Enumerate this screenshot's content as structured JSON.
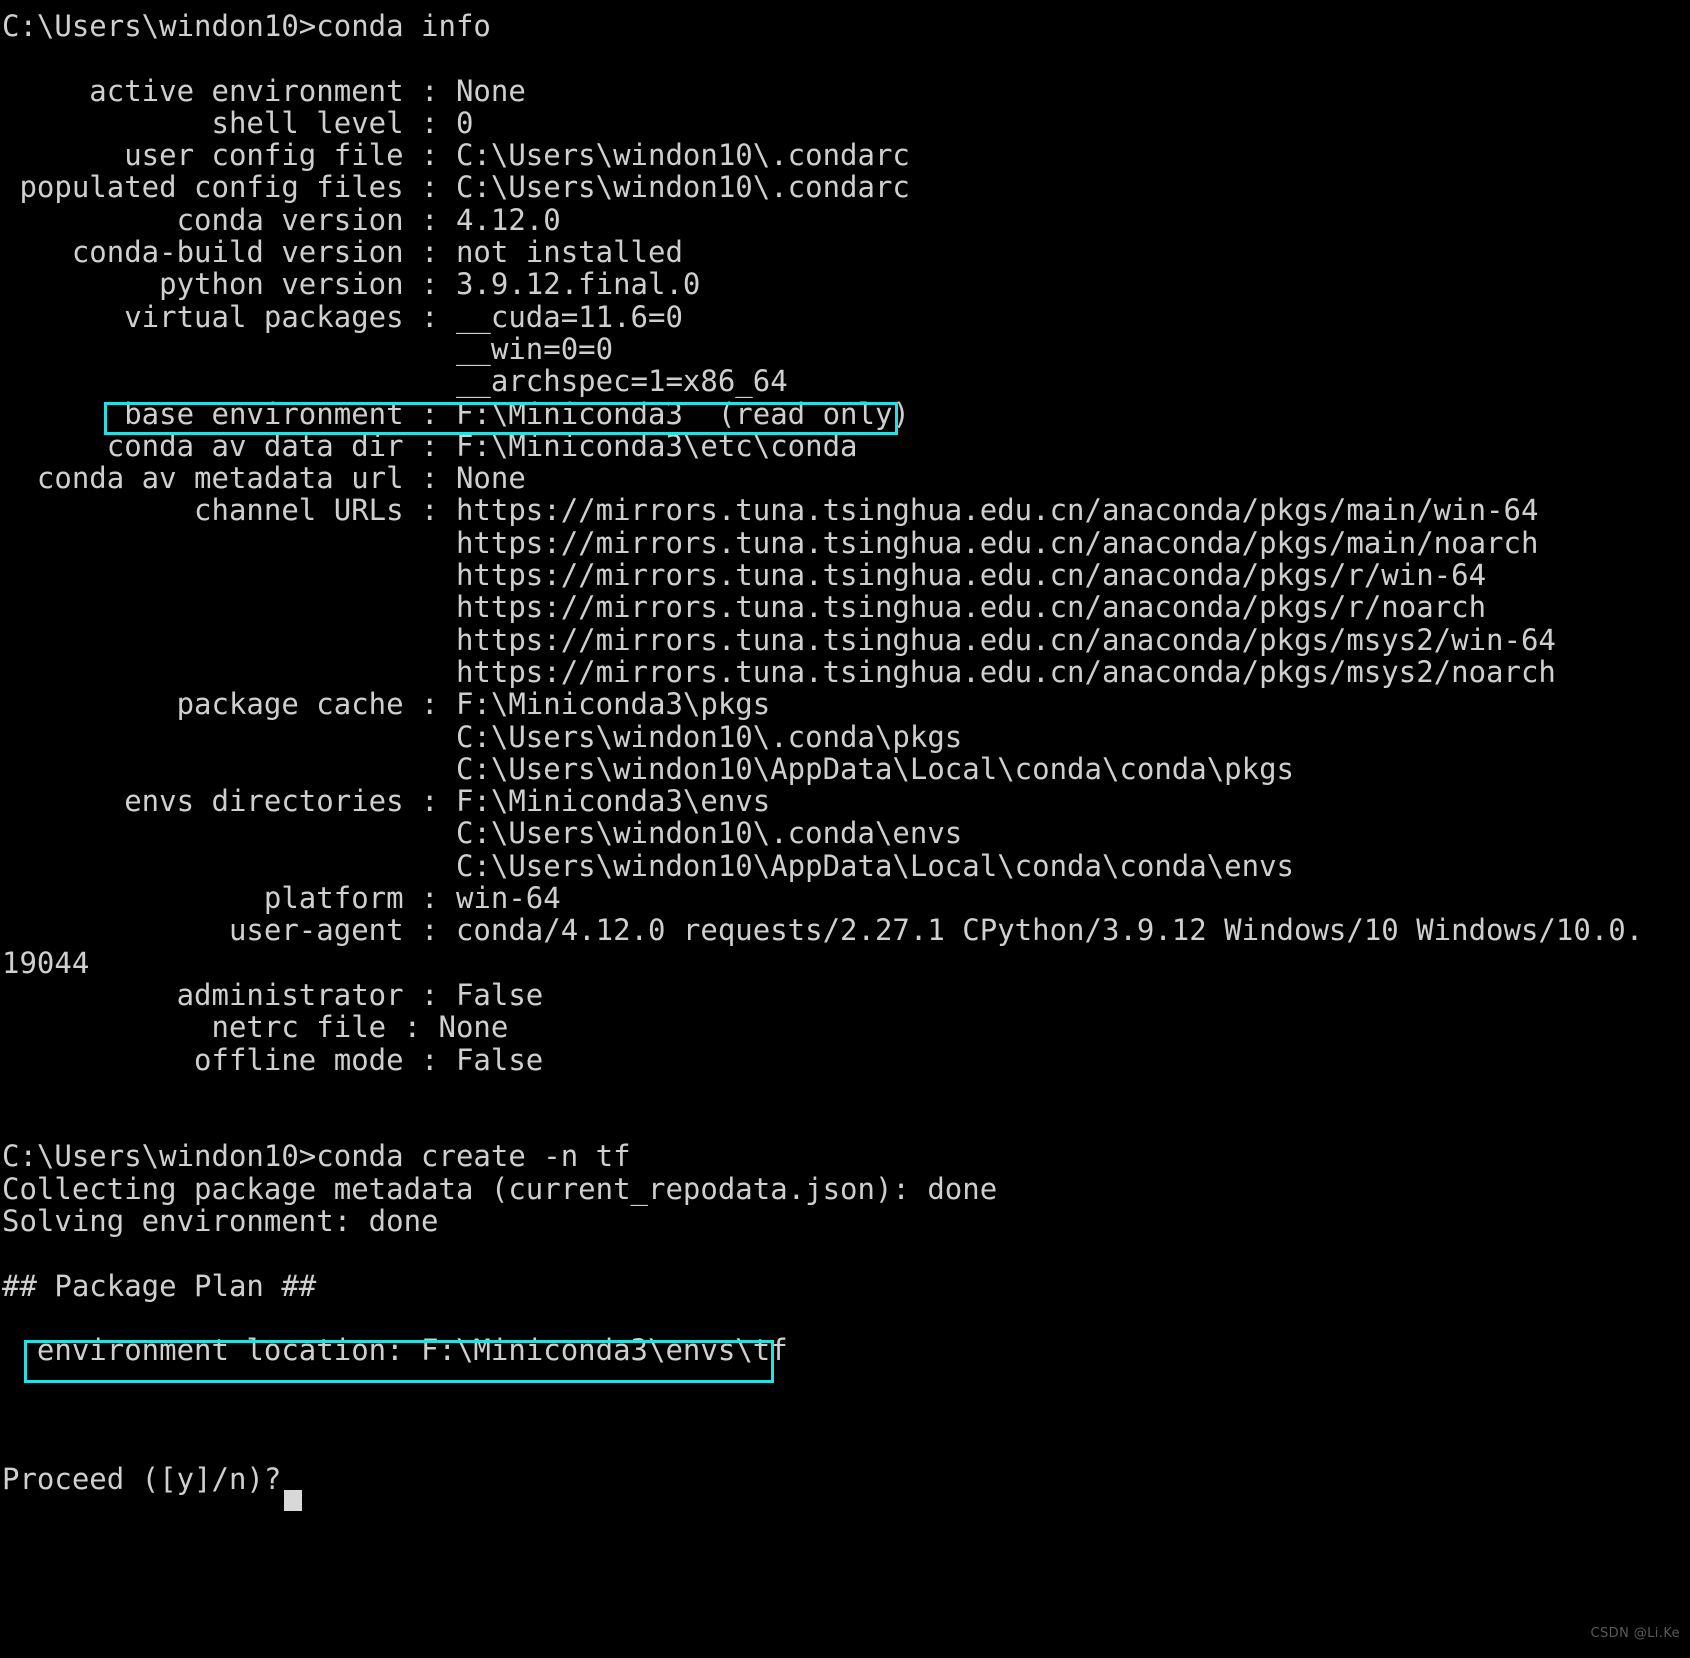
{
  "terminal": {
    "title": "Windows Command Prompt",
    "background_color": "#000000",
    "text_color": "#cfcfcf",
    "highlight_color": "#25e0e0",
    "cursor": "block-cursor"
  },
  "lines": [
    "C:\\Users\\windon10>conda info",
    "",
    "     active environment : None",
    "            shell level : 0",
    "       user config file : C:\\Users\\windon10\\.condarc",
    " populated config files : C:\\Users\\windon10\\.condarc",
    "          conda version : 4.12.0",
    "    conda-build version : not installed",
    "         python version : 3.9.12.final.0",
    "       virtual packages : __cuda=11.6=0",
    "                          __win=0=0",
    "                          __archspec=1=x86_64",
    "       base environment : F:\\Miniconda3  (read only)",
    "      conda av data dir : F:\\Miniconda3\\etc\\conda",
    "  conda av metadata url : None",
    "           channel URLs : https://mirrors.tuna.tsinghua.edu.cn/anaconda/pkgs/main/win-64",
    "                          https://mirrors.tuna.tsinghua.edu.cn/anaconda/pkgs/main/noarch",
    "                          https://mirrors.tuna.tsinghua.edu.cn/anaconda/pkgs/r/win-64",
    "                          https://mirrors.tuna.tsinghua.edu.cn/anaconda/pkgs/r/noarch",
    "                          https://mirrors.tuna.tsinghua.edu.cn/anaconda/pkgs/msys2/win-64",
    "                          https://mirrors.tuna.tsinghua.edu.cn/anaconda/pkgs/msys2/noarch",
    "          package cache : F:\\Miniconda3\\pkgs",
    "                          C:\\Users\\windon10\\.conda\\pkgs",
    "                          C:\\Users\\windon10\\AppData\\Local\\conda\\conda\\pkgs",
    "       envs directories : F:\\Miniconda3\\envs",
    "                          C:\\Users\\windon10\\.conda\\envs",
    "                          C:\\Users\\windon10\\AppData\\Local\\conda\\conda\\envs",
    "               platform : win-64",
    "             user-agent : conda/4.12.0 requests/2.27.1 CPython/3.9.12 Windows/10 Windows/10.0.",
    "19044",
    "          administrator : False",
    "            netrc file : None",
    "           offline mode : False",
    "",
    "",
    "C:\\Users\\windon10>conda create -n tf",
    "Collecting package metadata (current_repodata.json): done",
    "Solving environment: done",
    "",
    "## Package Plan ##",
    "",
    "  environment location: F:\\Miniconda3\\envs\\tf",
    "",
    "",
    "",
    "Proceed ([y]/n)? "
  ],
  "highlights": [
    {
      "name": "base-environment-highlight",
      "text": "base environment : F:\\Miniconda3  (read only)",
      "color": "#25e0e0"
    },
    {
      "name": "environment-location-highlight",
      "text": "environment location: F:\\Miniconda3\\envs\\tf",
      "color": "#25e0e0"
    }
  ],
  "prompt": {
    "command_1": "conda info",
    "command_2": "conda create -n tf",
    "prompt_path": "C:\\Users\\windon10>",
    "question": "Proceed ([y]/n)?"
  },
  "conda_info": {
    "active environment": "None",
    "shell level": "0",
    "user config file": "C:\\Users\\windon10\\.condarc",
    "populated config files": "C:\\Users\\windon10\\.condarc",
    "conda version": "4.12.0",
    "conda-build version": "not installed",
    "python version": "3.9.12.final.0",
    "virtual packages": [
      "__cuda=11.6=0",
      "__win=0=0",
      "__archspec=1=x86_64"
    ],
    "base environment": "F:\\Miniconda3  (read only)",
    "conda av data dir": "F:\\Miniconda3\\etc\\conda",
    "conda av metadata url": "None",
    "channel URLs": [
      "https://mirrors.tuna.tsinghua.edu.cn/anaconda/pkgs/main/win-64",
      "https://mirrors.tuna.tsinghua.edu.cn/anaconda/pkgs/main/noarch",
      "https://mirrors.tuna.tsinghua.edu.cn/anaconda/pkgs/r/win-64",
      "https://mirrors.tuna.tsinghua.edu.cn/anaconda/pkgs/r/noarch",
      "https://mirrors.tuna.tsinghua.edu.cn/anaconda/pkgs/msys2/win-64",
      "https://mirrors.tuna.tsinghua.edu.cn/anaconda/pkgs/msys2/noarch"
    ],
    "package cache": [
      "F:\\Miniconda3\\pkgs",
      "C:\\Users\\windon10\\.conda\\pkgs",
      "C:\\Users\\windon10\\AppData\\Local\\conda\\conda\\pkgs"
    ],
    "envs directories": [
      "F:\\Miniconda3\\envs",
      "C:\\Users\\windon10\\.conda\\envs",
      "C:\\Users\\windon10\\AppData\\Local\\conda\\conda\\envs"
    ],
    "platform": "win-64",
    "user-agent": "conda/4.12.0 requests/2.27.1 CPython/3.9.12 Windows/10 Windows/10.0.19044",
    "administrator": "False",
    "netrc file": "None",
    "offline mode": "False"
  },
  "package_plan": {
    "header": "## Package Plan ##",
    "environment_location_label": "environment location:",
    "environment_location_value": "F:\\Miniconda3\\envs\\tf"
  },
  "watermark": "CSDN @Li.Ke"
}
